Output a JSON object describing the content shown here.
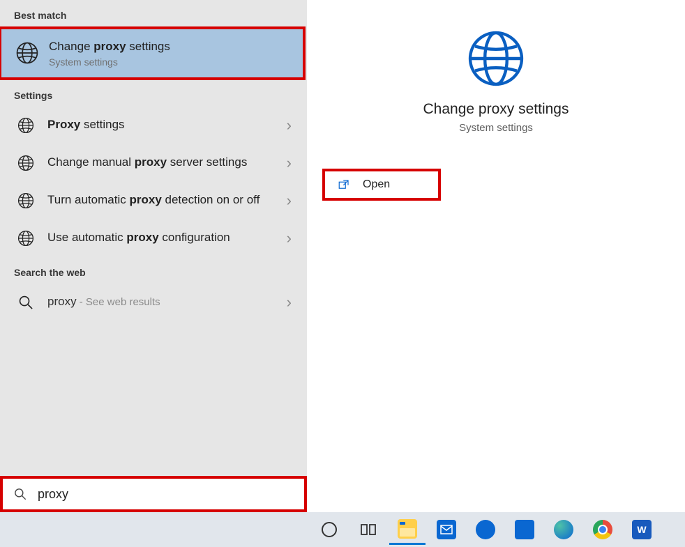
{
  "best_match": {
    "header": "Best match",
    "item": {
      "title_pre": "Change ",
      "title_bold": "proxy",
      "title_post": " settings",
      "sub": "System settings"
    }
  },
  "settings": {
    "header": "Settings",
    "items": [
      {
        "pre": "",
        "bold": "Proxy",
        "post": " settings"
      },
      {
        "pre": "Change manual ",
        "bold": "proxy",
        "post": " server settings"
      },
      {
        "pre": "Turn automatic ",
        "bold": "proxy",
        "post": " detection on or off"
      },
      {
        "pre": "Use automatic ",
        "bold": "proxy",
        "post": " configuration"
      }
    ]
  },
  "web": {
    "header": "Search the web",
    "item": {
      "query": "proxy",
      "hint": " - See web results"
    }
  },
  "search": {
    "value": "proxy"
  },
  "detail": {
    "title": "Change proxy settings",
    "sub": "System settings",
    "action": "Open"
  },
  "taskbar": {
    "items": [
      {
        "name": "cortana-icon",
        "kind": "circle"
      },
      {
        "name": "task-view-icon",
        "kind": "taskview"
      },
      {
        "name": "file-explorer-icon",
        "kind": "explorer"
      },
      {
        "name": "mail-icon",
        "kind": "mail"
      },
      {
        "name": "app1-icon",
        "kind": "bluebox"
      },
      {
        "name": "app2-icon",
        "kind": "bluebox2"
      },
      {
        "name": "edge-icon",
        "kind": "edge"
      },
      {
        "name": "chrome-icon",
        "kind": "chrome"
      },
      {
        "name": "word-icon",
        "kind": "word"
      }
    ]
  }
}
